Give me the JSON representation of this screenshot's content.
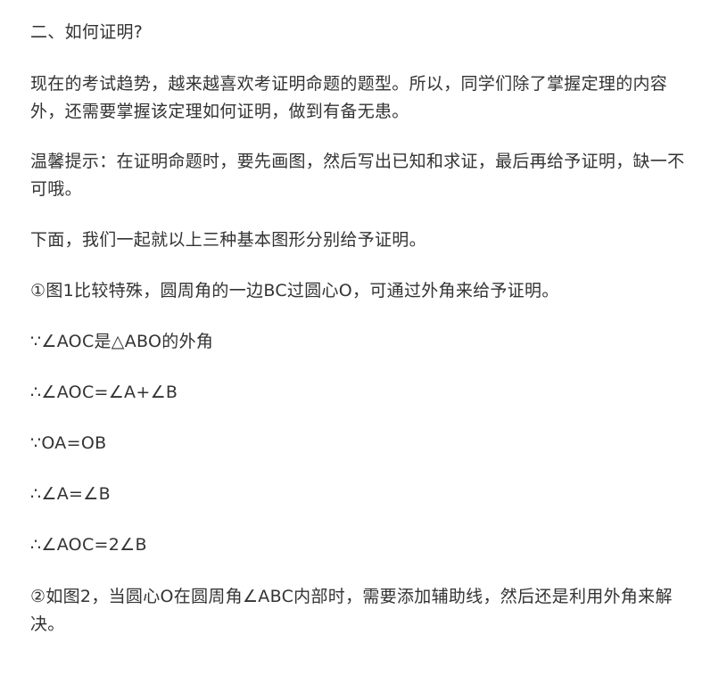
{
  "article": {
    "heading": "二、如何证明?",
    "p1": "现在的考试趋势，越来越喜欢考证明命题的题型。所以，同学们除了掌握定理的内容外，还需要掌握该定理如何证明，做到有备无患。",
    "p2": "温馨提示：在证明命题时，要先画图，然后写出已知和求证，最后再给予证明，缺一不可哦。",
    "p3": "下面，我们一起就以上三种基本图形分别给予证明。",
    "p4": "①图1比较特殊，圆周角的一边BC过圆心O，可通过外角来给予证明。",
    "step1": "∵∠AOC是△ABO的外角",
    "step2": "∴∠AOC=∠A+∠B",
    "step3": "∵OA=OB",
    "step4": "∴∠A=∠B",
    "step5": "∴∠AOC=2∠B",
    "p5": "②如图2，当圆心O在圆周角∠ABC内部时，需要添加辅助线，然后还是利用外角来解决。"
  }
}
